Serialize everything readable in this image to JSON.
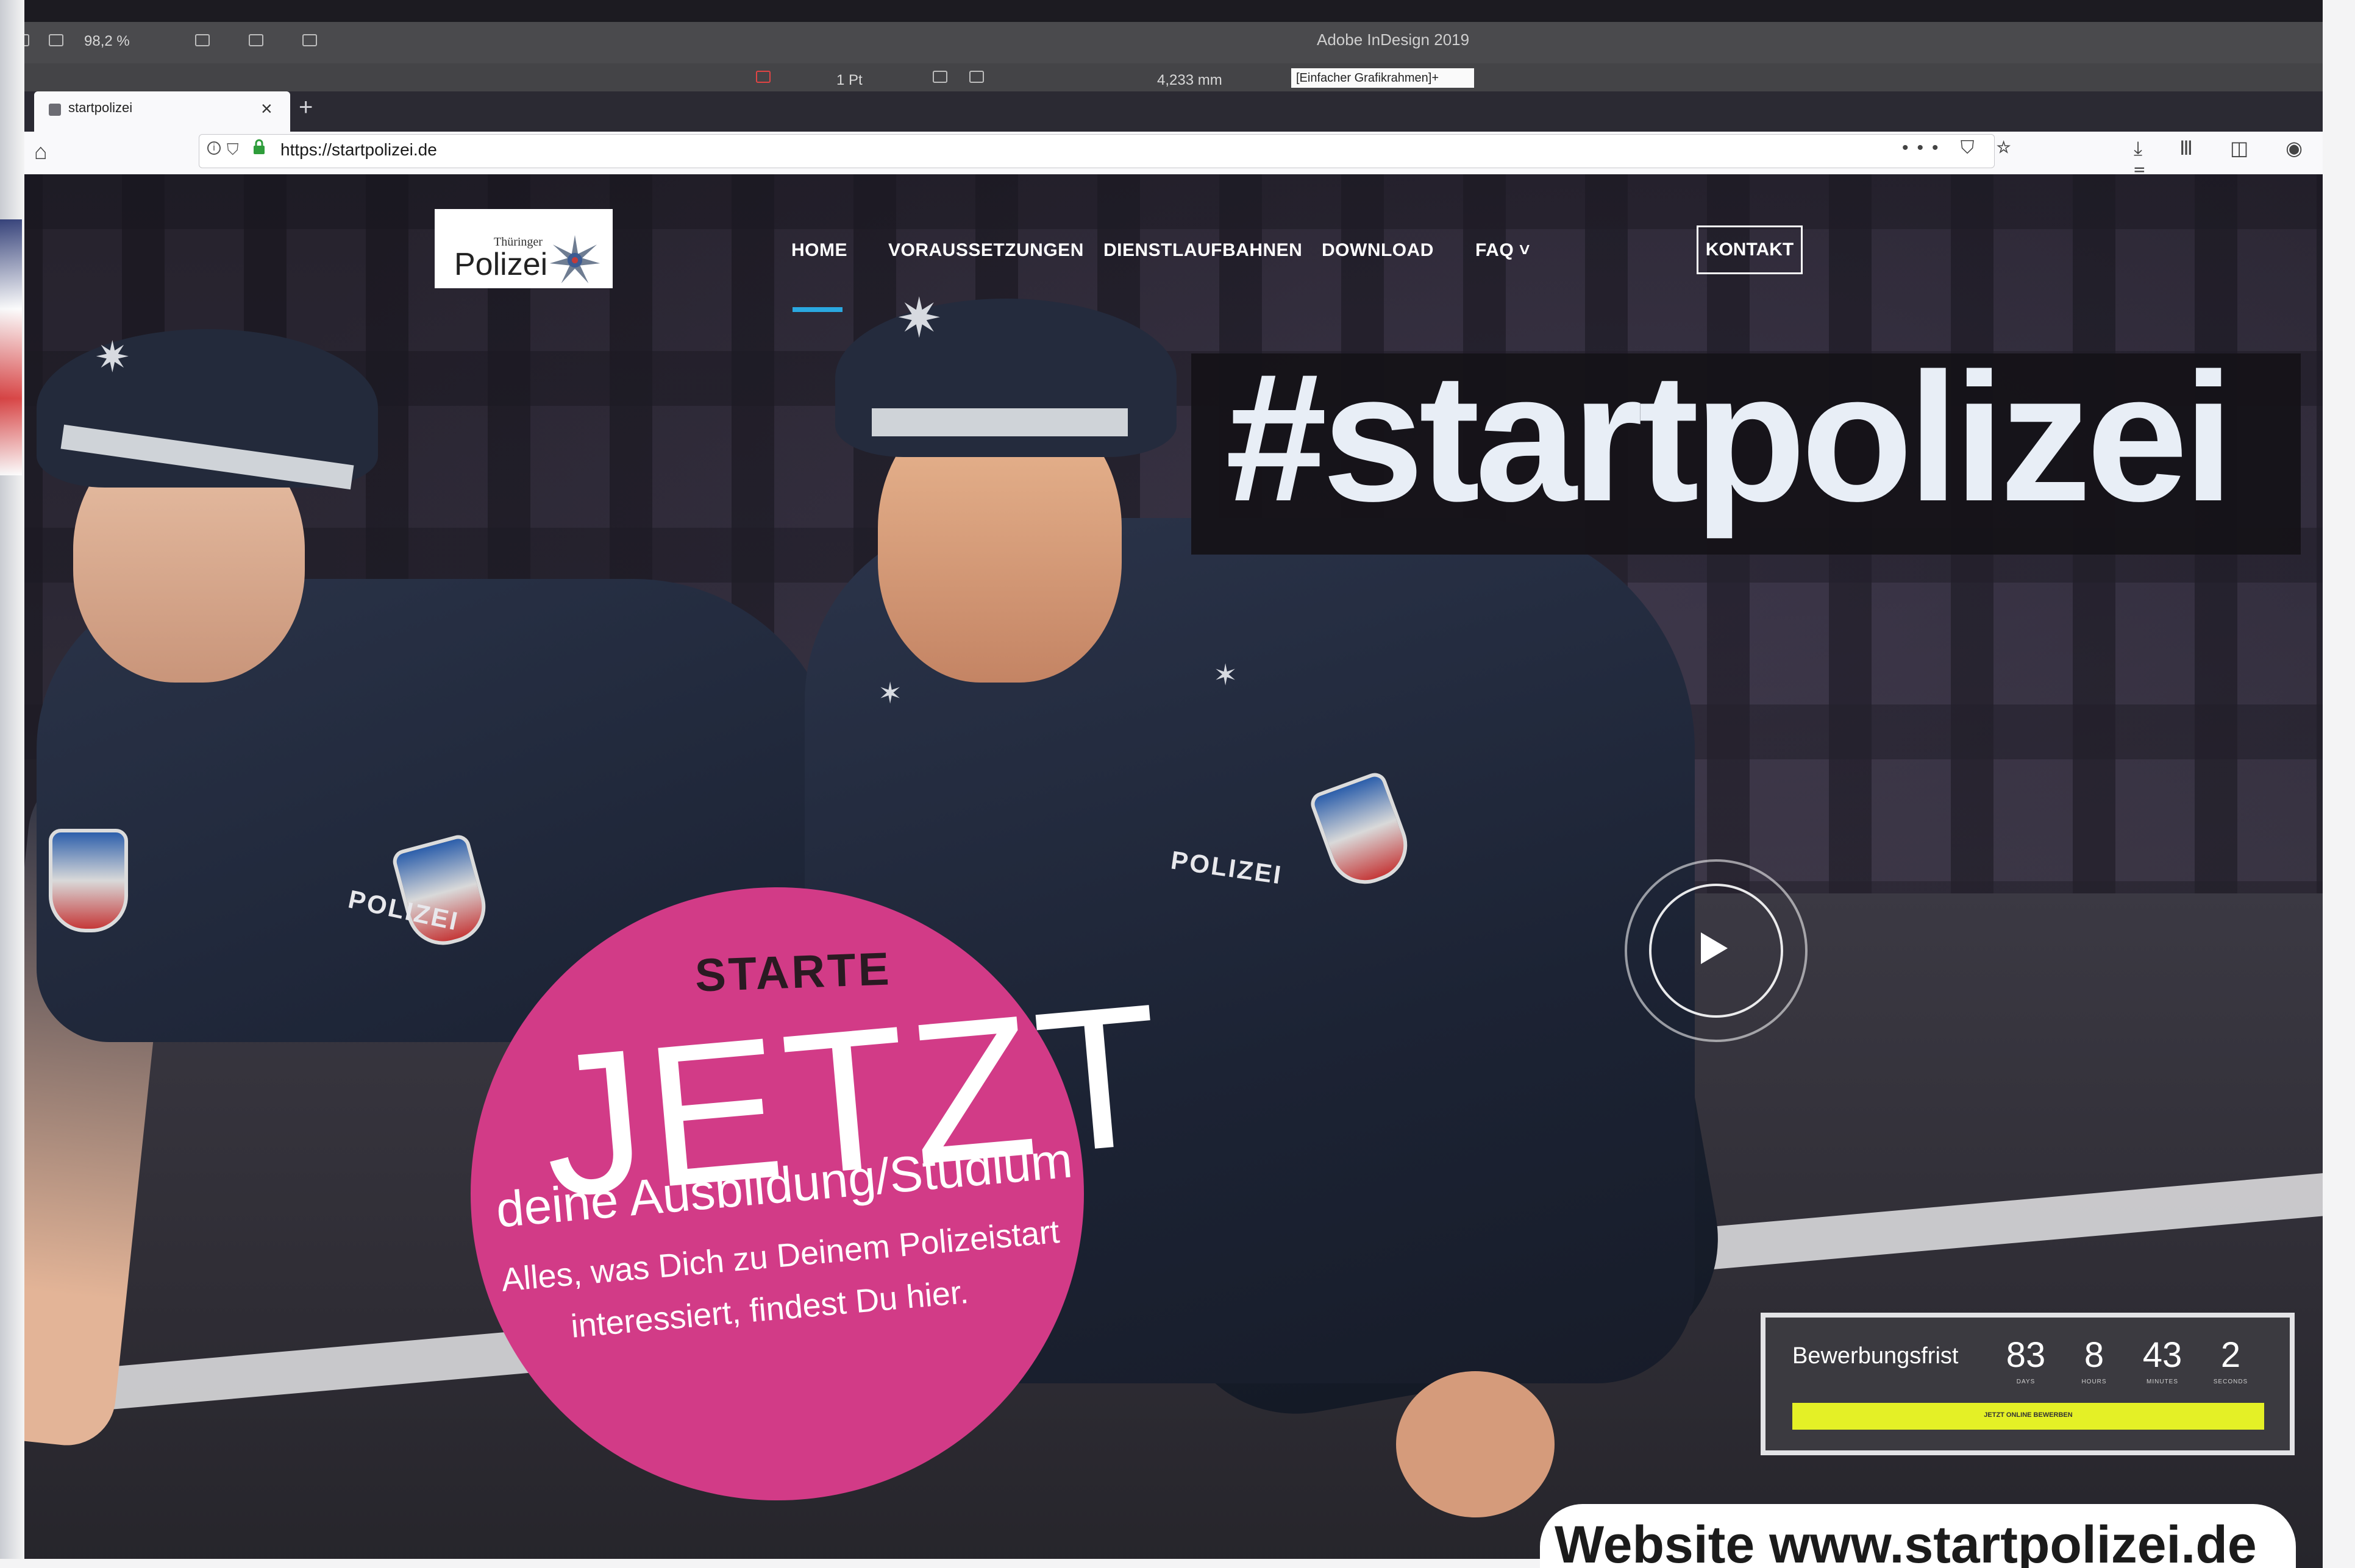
{
  "indesign": {
    "title": "Adobe InDesign 2019",
    "zoom": "98,2 %",
    "stroke": "1 Pt",
    "size": "4,233 mm",
    "frame_style": "[Einfacher Grafikrahmen]+"
  },
  "browser": {
    "tab_title": "startpolizei",
    "tab_close": "×",
    "new_tab": "+",
    "url": "https://startpolizei.de",
    "page_actions": "••• ⛉ ☆",
    "toolbar_icons": "⤓ Ⅲ ◫ ◉ ≡"
  },
  "site": {
    "logo": {
      "sub": "Thüringer",
      "main": "Polizei"
    },
    "nav": [
      {
        "label": "HOME",
        "active": true
      },
      {
        "label": "VORAUSSETZUNGEN"
      },
      {
        "label": "DIENSTLAUFBAHNEN"
      },
      {
        "label": "DOWNLOAD"
      },
      {
        "label": "FAQ ˅"
      }
    ],
    "kontakt": "KONTAKT",
    "hashtag": "#startpolizei",
    "uniform_label": "POLIZEI",
    "promo": {
      "line1": "STARTE",
      "line2": "JETZT",
      "line3": "deine Ausbildung/Studium",
      "line4": "Alles, was Dich zu Deinem Polizeistart",
      "line5": "interessiert, findest Du hier."
    },
    "countdown": {
      "label": "Bewerbungsfrist",
      "items": [
        {
          "value": "83",
          "unit": "DAYS"
        },
        {
          "value": "8",
          "unit": "HOURS"
        },
        {
          "value": "43",
          "unit": "MINUTES"
        },
        {
          "value": "2",
          "unit": "SECONDS"
        }
      ],
      "button": "JETZT ONLINE BEWERBEN"
    }
  },
  "caption": "Website www.startpolizei.de",
  "colors": {
    "accent_blue": "#2aa8e0",
    "promo_pink": "#d23b87",
    "apply_yellow": "#e4f026"
  }
}
